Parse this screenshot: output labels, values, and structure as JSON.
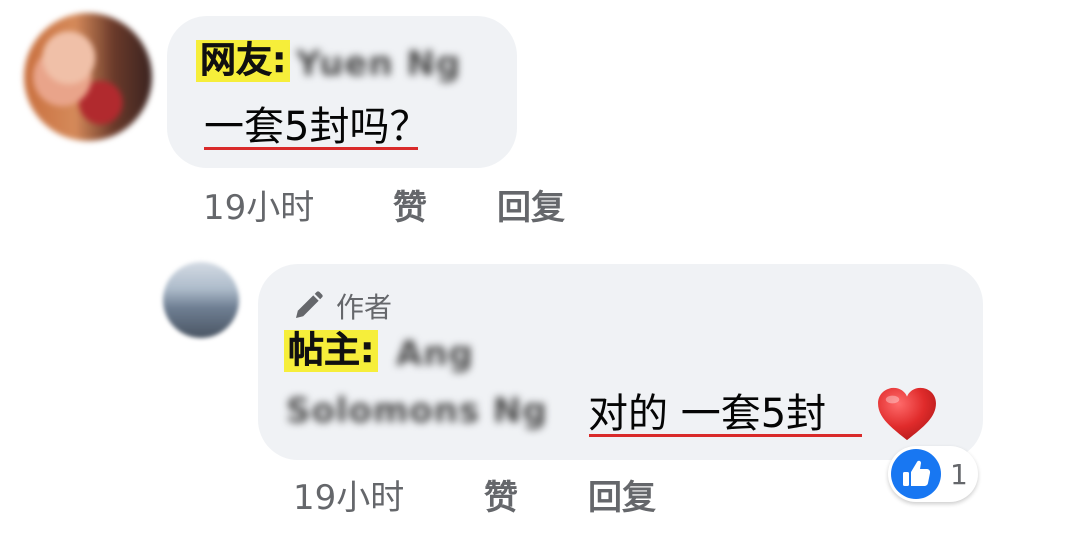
{
  "comment1": {
    "tag": "网友:",
    "author_blurred": "Yuen Ng",
    "text": "一套5封吗？",
    "time": "19小时",
    "like_label": "赞",
    "reply_label": "回复"
  },
  "comment2": {
    "badge_label": "作者",
    "tag": "帖主:",
    "author_blurred_line1": "Ang",
    "author_blurred_line2": "Solomons Ng",
    "text": "对的 一套5封",
    "time": "19小时",
    "like_label": "赞",
    "reply_label": "回复",
    "reaction_count": "1"
  },
  "colors": {
    "bubble": "#f0f2f5",
    "highlight": "#f6ee3a",
    "underline": "#d92a2a",
    "meta_text": "#65676b",
    "like_blue": "#1877f2",
    "heart_red": "#e02b2b"
  },
  "icons": {
    "pencil": "pencil-icon",
    "heart": "heart-icon",
    "thumbs_up": "thumbs-up-icon"
  }
}
